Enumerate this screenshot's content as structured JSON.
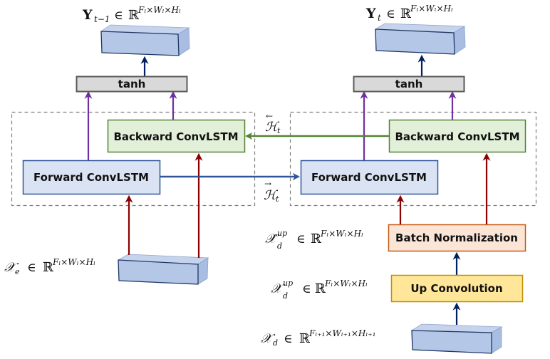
{
  "diagram": {
    "title": "",
    "labels": {
      "y_prev": {
        "base": "Y",
        "sub": "t−1",
        "in": "∈",
        "set": "ℝ",
        "sup": "Fₗ×Wₗ×Hₗ"
      },
      "y_curr": {
        "base": "Y",
        "sub": "t",
        "in": "∈",
        "set": "ℝ",
        "sup": "Fₗ×Wₗ×Hₗ"
      },
      "h_backward": {
        "base": "ℋ",
        "sub": "t",
        "accent": "←"
      },
      "h_forward": {
        "base": "ℋ",
        "sub": "t",
        "accent": "→"
      },
      "x_e": {
        "base": "𝒳",
        "sub": "e",
        "in": "∈",
        "set": "ℝ",
        "sup": "Fₗ×Wₗ×Hₗ"
      },
      "x_d_up_hat": {
        "base": "𝒳̂",
        "sub": "d",
        "super": "up",
        "in": "∈",
        "set": "ℝ",
        "sup": "Fₗ×Wₗ×Hₗ"
      },
      "x_d_up": {
        "base": "𝒳",
        "sub": "d",
        "super": "up",
        "in": "∈",
        "set": "ℝ",
        "sup": "Fₗ×Wₗ×Hₗ"
      },
      "x_d": {
        "base": "𝒳",
        "sub": "d",
        "in": "∈",
        "set": "ℝ",
        "sup": "Fₗ₊₁×Wₗ₊₁×Hₗ₊₁"
      }
    },
    "nodes": {
      "tanh_left": "tanh",
      "tanh_right": "tanh",
      "backward_left": "Backward ConvLSTM",
      "forward_left": "Forward ConvLSTM",
      "backward_right": "Backward ConvLSTM",
      "forward_right": "Forward ConvLSTM",
      "batch_norm": "Batch Normalization",
      "up_conv": "Up Convolution"
    },
    "colors": {
      "tensor_fill": "#b4c7e7",
      "tensor_stroke": "#203864",
      "tanh_fill": "#d9d9d9",
      "tanh_stroke": "#595959",
      "backward_fill": "#e2efd9",
      "backward_stroke": "#548235",
      "forward_fill": "#dae3f3",
      "forward_stroke": "#2f5597",
      "batchnorm_fill": "#fbe5d6",
      "batchnorm_stroke": "#c55a11",
      "upconv_fill": "#ffe699",
      "upconv_stroke": "#bf9000",
      "arrow_purple": "#7030a0",
      "arrow_red": "#8b0000",
      "arrow_navy": "#002060",
      "arrow_green": "#548235",
      "arrow_blue": "#2f5597",
      "dashed": "#7f7f7f"
    }
  }
}
